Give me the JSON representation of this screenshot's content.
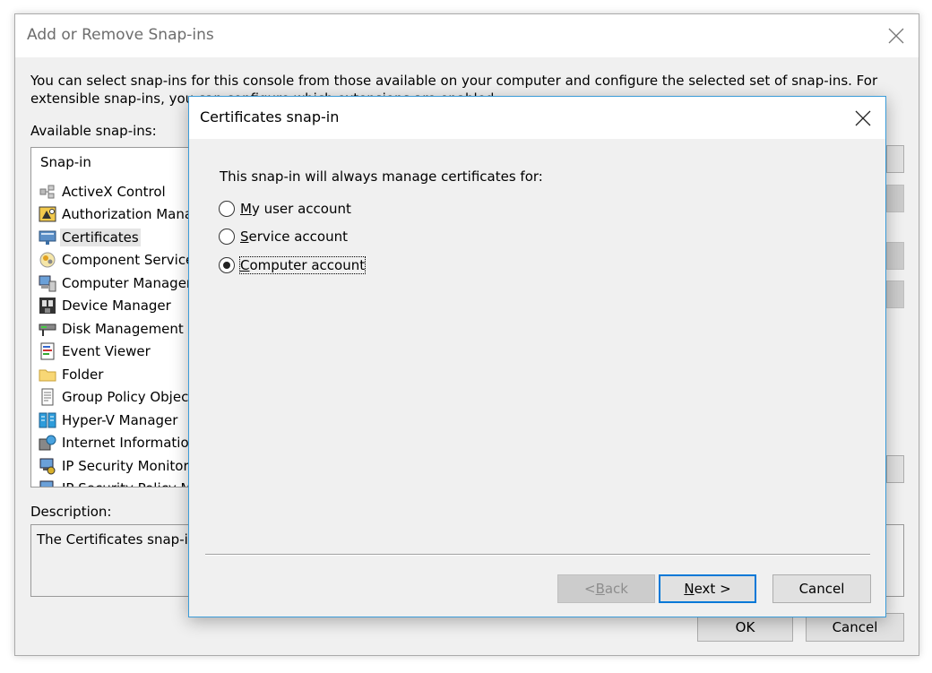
{
  "outer_dialog": {
    "title": "Add or Remove Snap-ins",
    "description": "You can select snap-ins for this console from those available on your computer and configure the selected set of snap-ins. For extensible snap-ins, you can configure which extensions are enabled.",
    "available_label": "Available snap-ins:",
    "list_header": "Snap-in",
    "snapins": [
      {
        "label": "ActiveX Control",
        "icon": "activex-icon"
      },
      {
        "label": "Authorization Manager",
        "icon": "authorization-icon"
      },
      {
        "label": "Certificates",
        "icon": "certificates-icon"
      },
      {
        "label": "Component Services",
        "icon": "component-services-icon"
      },
      {
        "label": "Computer Management",
        "icon": "computer-management-icon"
      },
      {
        "label": "Device Manager",
        "icon": "device-manager-icon"
      },
      {
        "label": "Disk Management",
        "icon": "disk-management-icon"
      },
      {
        "label": "Event Viewer",
        "icon": "event-viewer-icon"
      },
      {
        "label": "Folder",
        "icon": "folder-icon"
      },
      {
        "label": "Group Policy Object",
        "icon": "group-policy-icon"
      },
      {
        "label": "Hyper-V Manager",
        "icon": "hyperv-icon"
      },
      {
        "label": "Internet Information Services",
        "icon": "iis-icon"
      },
      {
        "label": "IP Security Monitor",
        "icon": "ip-security-monitor-icon"
      },
      {
        "label": "IP Security Policy Management",
        "icon": "ip-security-policy-icon"
      }
    ],
    "selected_snapin": "Certificates",
    "description_label": "Description:",
    "description_text": "The Certificates snap-in allows you to browse the contents of the certificate stores for yourself, a service, or a computer.",
    "ok_label": "OK",
    "cancel_label": "Cancel"
  },
  "inner_dialog": {
    "title": "Certificates snap-in",
    "prompt": "This snap-in will always manage certificates for:",
    "options": [
      {
        "accel": "M",
        "rest": "y user account",
        "checked": false
      },
      {
        "accel": "S",
        "rest": "ervice account",
        "checked": false
      },
      {
        "accel": "C",
        "rest": "omputer account",
        "checked": true
      }
    ],
    "back_accel": "B",
    "back_prefix": "< ",
    "back_rest": "ack",
    "next_accel": "N",
    "next_rest": "ext >",
    "cancel_label": "Cancel"
  },
  "colors": {
    "dialog_bg": "#f0f0f0",
    "accent_border": "#3c9cd8",
    "default_button_border": "#0078d7"
  }
}
